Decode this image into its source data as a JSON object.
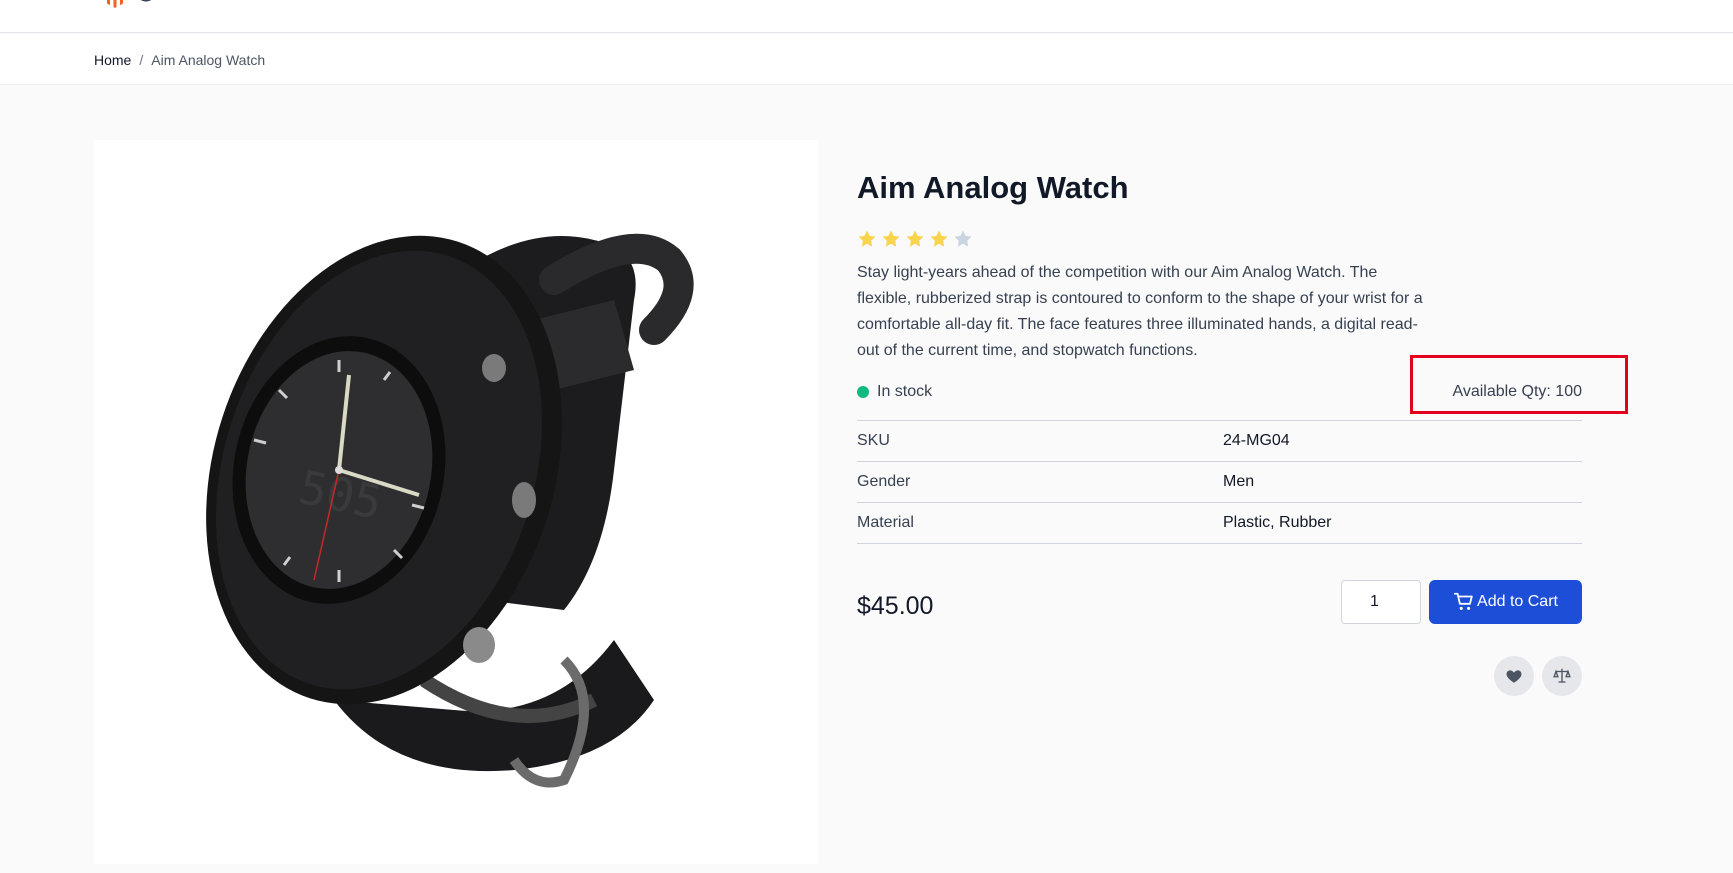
{
  "header": {
    "logo_icon": "magento-logo-icon"
  },
  "breadcrumb": {
    "home": "Home",
    "separator": "/",
    "current": "Aim Analog Watch"
  },
  "product": {
    "title": "Aim Analog Watch",
    "rating": {
      "filled": 4,
      "max": 5,
      "filled_color": "#fcd34d",
      "empty_color": "#cbd5e1"
    },
    "description": "Stay light-years ahead of the competition with our Aim Analog Watch. The flexible, rubberized strap is contoured to conform to the shape of your wrist for a comfortable all-day fit. The face features three illuminated hands, a digital read-out of the current time, and stopwatch functions.",
    "stock_status": "In stock",
    "available_qty": "Available Qty: 100",
    "attributes": [
      {
        "label": "SKU",
        "value": "24-MG04"
      },
      {
        "label": "Gender",
        "value": "Men"
      },
      {
        "label": "Material",
        "value": "Plastic, Rubber"
      }
    ],
    "price": "$45.00",
    "quantity": "1",
    "add_to_cart": "Add to Cart",
    "image_icon": "watch-product-image"
  },
  "colors": {
    "primary_button": "#1d4ed8",
    "stock_dot": "#10b981",
    "highlight_box": "#e3001b",
    "logo": "#f26322"
  },
  "icons": {
    "cart": "cart-icon",
    "wishlist": "heart-icon",
    "compare": "scale-icon"
  }
}
